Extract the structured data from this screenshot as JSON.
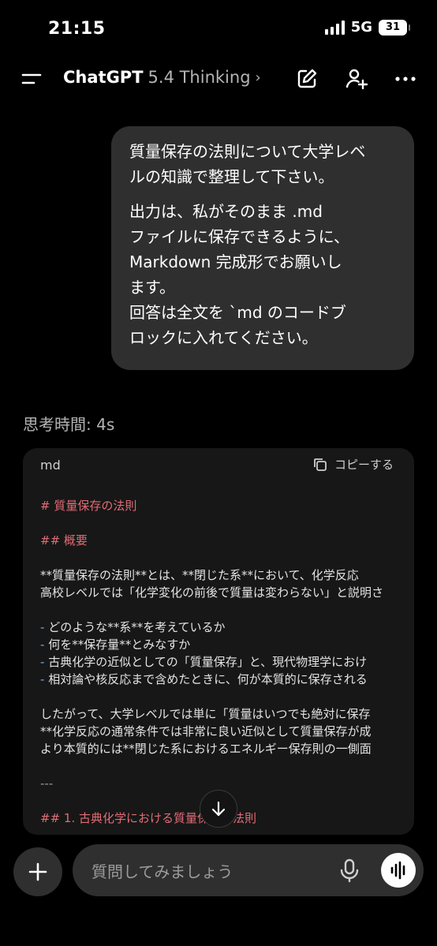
{
  "status": {
    "time": "21:15",
    "network": "5G",
    "battery": "31"
  },
  "header": {
    "app_name": "ChatGPT",
    "model": "5.4 Thinking",
    "chevron": "›"
  },
  "user_message": {
    "paragraph1": "質量保存の法則について大学レベ\nルの知識で整理して下さい。",
    "paragraph2": "出力は、私がそのまま .md\nファイルに保存できるように、\nMarkdown 完成形でお願いし\nます。\n回答は全文を `md のコードブ\nロックに入れてください。"
  },
  "thinking_time": "思考時間: 4s",
  "code_block": {
    "language": "md",
    "copy_label": "コピーする",
    "lines": [
      "# 質量保存の法則",
      "",
      "## 概要",
      "",
      "**質量保存の法則**とは、**閉じた系**において、化学反応",
      "高校レベルでは「化学変化の前後で質量は変わらない」と説明さ",
      "",
      "- どのような**系**を考えているか",
      "- 何を**保存量**とみなすか",
      "- 古典化学の近似としての「質量保存」と、現代物理学におけ",
      "- 相対論や核反応まで含めたときに、何が本質的に保存される",
      "",
      "したがって、大学レベルでは単に「質量はいつでも絶対に保存",
      "**化学反応の通常条件では非常に良い近似として質量保存が成",
      "より本質的には**閉じた系におけるエネルギー保存則の一側面",
      "",
      "---",
      "",
      "## 1. 古典化学における質量保存の法則"
    ]
  },
  "composer": {
    "placeholder": "質問してみましょう"
  },
  "icons": {
    "menu": "menu-icon",
    "new_chat": "edit-icon",
    "add_person": "add-person-icon",
    "more": "more-icon",
    "copy": "copy-icon",
    "scroll_down": "arrow-down-icon",
    "plus": "plus-icon",
    "mic": "mic-icon",
    "voice": "voice-waveform-icon"
  }
}
